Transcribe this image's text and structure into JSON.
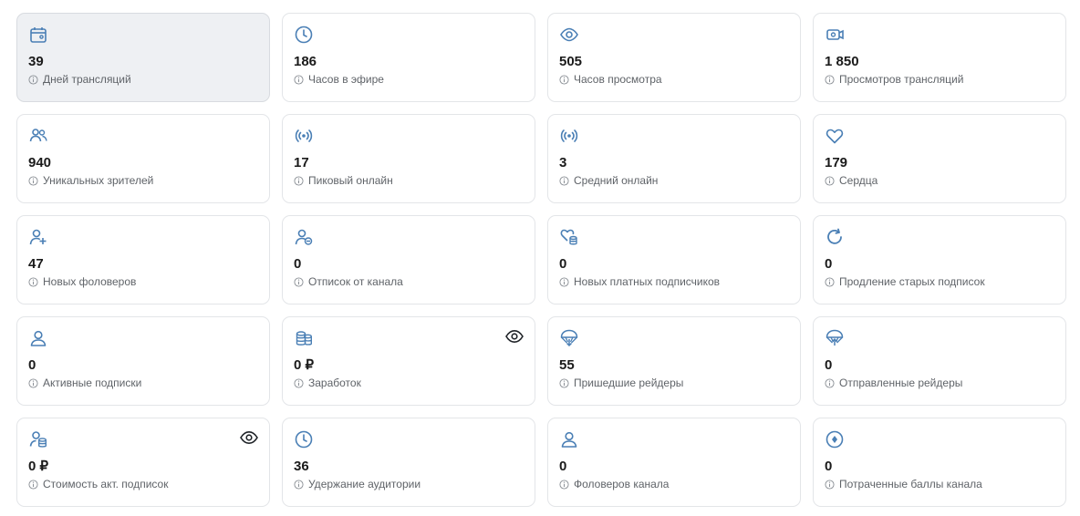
{
  "colors": {
    "icon": "#4a7fb5",
    "selected_bg": "#eef0f3",
    "border": "#e3e5e8",
    "label": "#5f6368",
    "value": "#1a1a1a"
  },
  "cards": [
    {
      "value": "39",
      "label": "Дней трансляций",
      "icon": "calendar-icon",
      "selected": true
    },
    {
      "value": "186",
      "label": "Часов в эфире",
      "icon": "clock-icon"
    },
    {
      "value": "505",
      "label": "Часов просмотра",
      "icon": "eye-icon"
    },
    {
      "value": "1 850",
      "label": "Просмотров трансляций",
      "icon": "camera-icon"
    },
    {
      "value": "940",
      "label": "Уникальных зрителей",
      "icon": "users-icon"
    },
    {
      "value": "17",
      "label": "Пиковый онлайн",
      "icon": "broadcast-icon"
    },
    {
      "value": "3",
      "label": "Средний онлайн",
      "icon": "broadcast-icon"
    },
    {
      "value": "179",
      "label": "Сердца",
      "icon": "heart-icon"
    },
    {
      "value": "47",
      "label": "Новых фоловеров",
      "icon": "user-plus-icon"
    },
    {
      "value": "0",
      "label": "Отписок от канала",
      "icon": "user-minus-icon"
    },
    {
      "value": "0",
      "label": "Новых платных подписчиков",
      "icon": "heart-coins-icon"
    },
    {
      "value": "0",
      "label": "Продление старых подписок",
      "icon": "refresh-icon"
    },
    {
      "value": "0",
      "label": "Активные подписки",
      "icon": "user-icon"
    },
    {
      "value": "0 ₽",
      "label": "Заработок",
      "icon": "coins-icon",
      "eye": true
    },
    {
      "value": "55",
      "label": "Пришедшие рейдеры",
      "icon": "parachute-down-icon"
    },
    {
      "value": "0",
      "label": "Отправленные рейдеры",
      "icon": "parachute-up-icon"
    },
    {
      "value": "0 ₽",
      "label": "Стоимость акт. подписок",
      "icon": "user-coins-icon",
      "eye": true
    },
    {
      "value": "36",
      "label": "Удержание аудитории",
      "icon": "clock-icon"
    },
    {
      "value": "0",
      "label": "Фоловеров канала",
      "icon": "user-icon"
    },
    {
      "value": "0",
      "label": "Потраченные баллы канала",
      "icon": "points-icon"
    }
  ]
}
